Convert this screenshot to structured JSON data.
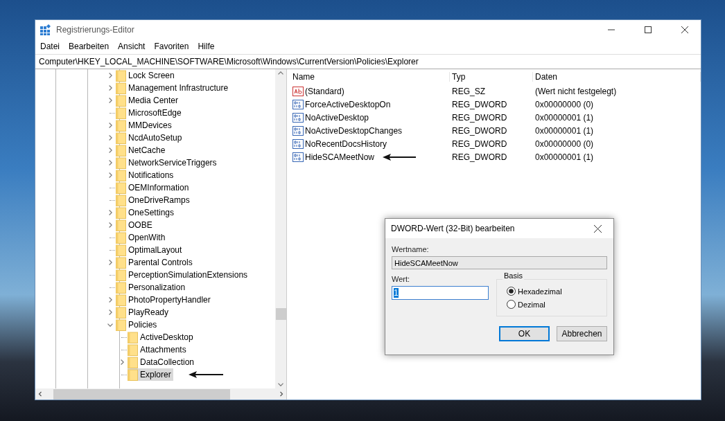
{
  "window": {
    "title": "Registrierungs-Editor"
  },
  "menu": [
    "Datei",
    "Bearbeiten",
    "Ansicht",
    "Favoriten",
    "Hilfe"
  ],
  "address": "Computer\\HKEY_LOCAL_MACHINE\\SOFTWARE\\Microsoft\\Windows\\CurrentVersion\\Policies\\Explorer",
  "tree": [
    {
      "label": "Lock Screen",
      "expandable": true,
      "expanded": false,
      "selected": false
    },
    {
      "label": "Management Infrastructure",
      "expandable": true,
      "expanded": false,
      "selected": false
    },
    {
      "label": "Media Center",
      "expandable": true,
      "expanded": false,
      "selected": false
    },
    {
      "label": "MicrosoftEdge",
      "expandable": false,
      "selected": false
    },
    {
      "label": "MMDevices",
      "expandable": true,
      "expanded": false,
      "selected": false
    },
    {
      "label": "NcdAutoSetup",
      "expandable": true,
      "expanded": false,
      "selected": false
    },
    {
      "label": "NetCache",
      "expandable": true,
      "expanded": false,
      "selected": false
    },
    {
      "label": "NetworkServiceTriggers",
      "expandable": true,
      "expanded": false,
      "selected": false
    },
    {
      "label": "Notifications",
      "expandable": true,
      "expanded": false,
      "selected": false
    },
    {
      "label": "OEMInformation",
      "expandable": false,
      "selected": false
    },
    {
      "label": "OneDriveRamps",
      "expandable": false,
      "selected": false
    },
    {
      "label": "OneSettings",
      "expandable": true,
      "expanded": false,
      "selected": false
    },
    {
      "label": "OOBE",
      "expandable": true,
      "expanded": false,
      "selected": false
    },
    {
      "label": "OpenWith",
      "expandable": false,
      "selected": false
    },
    {
      "label": "OptimalLayout",
      "expandable": false,
      "selected": false
    },
    {
      "label": "Parental Controls",
      "expandable": true,
      "expanded": false,
      "selected": false
    },
    {
      "label": "PerceptionSimulationExtensions",
      "expandable": false,
      "selected": false
    },
    {
      "label": "Personalization",
      "expandable": false,
      "selected": false
    },
    {
      "label": "PhotoPropertyHandler",
      "expandable": true,
      "expanded": false,
      "selected": false
    },
    {
      "label": "PlayReady",
      "expandable": true,
      "expanded": false,
      "selected": false
    },
    {
      "label": "Policies",
      "expandable": true,
      "expanded": true,
      "selected": false,
      "children": [
        {
          "label": "ActiveDesktop",
          "expandable": false,
          "selected": false
        },
        {
          "label": "Attachments",
          "expandable": false,
          "selected": false
        },
        {
          "label": "DataCollection",
          "expandable": true,
          "expanded": false,
          "selected": false
        },
        {
          "label": "Explorer",
          "expandable": false,
          "selected": true
        }
      ]
    }
  ],
  "values": {
    "columns": [
      "Name",
      "Typ",
      "Daten"
    ],
    "rows": [
      {
        "kind": "string",
        "name": "(Standard)",
        "type": "REG_SZ",
        "data": "(Wert nicht festgelegt)"
      },
      {
        "kind": "dword",
        "name": "ForceActiveDesktopOn",
        "type": "REG_DWORD",
        "data": "0x00000000 (0)"
      },
      {
        "kind": "dword",
        "name": "NoActiveDesktop",
        "type": "REG_DWORD",
        "data": "0x00000001 (1)"
      },
      {
        "kind": "dword",
        "name": "NoActiveDesktopChanges",
        "type": "REG_DWORD",
        "data": "0x00000001 (1)"
      },
      {
        "kind": "dword",
        "name": "NoRecentDocsHistory",
        "type": "REG_DWORD",
        "data": "0x00000000 (0)"
      },
      {
        "kind": "dword",
        "name": "HideSCAMeetNow",
        "type": "REG_DWORD",
        "data": "0x00000001 (1)"
      }
    ]
  },
  "dialog": {
    "title": "DWORD-Wert (32-Bit) bearbeiten",
    "name_label": "Wertname:",
    "name_value": "HideSCAMeetNow",
    "value_label": "Wert:",
    "value": "1",
    "base_label": "Basis",
    "bases": [
      {
        "label": "Hexadezimal",
        "selected": true
      },
      {
        "label": "Dezimal",
        "selected": false
      }
    ],
    "buttons": [
      "OK",
      "Abbrechen"
    ]
  }
}
